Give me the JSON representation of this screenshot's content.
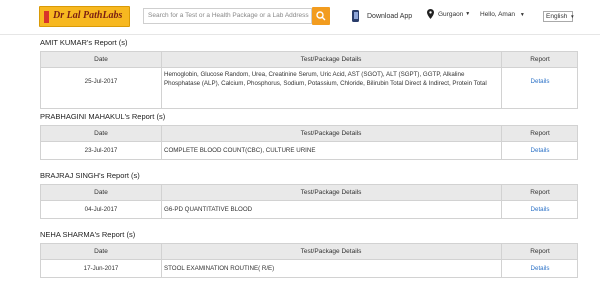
{
  "header": {
    "logo_text": "Dr Lal PathLabs",
    "search_placeholder": "Search for a Test or a Health Package or a Lab Address",
    "download_label": "Download App",
    "location": "Gurgaon",
    "greeting": "Hello, Aman",
    "language": "English"
  },
  "columns": {
    "date": "Date",
    "test": "Test/Package Details",
    "report": "Report"
  },
  "reports": [
    {
      "title": "AMIT KUMAR's Report (s)",
      "date": "25-Jul-2017",
      "tests": "Hemoglobin, Glucose Random, Urea, Creatinine Serum, Uric Acid, AST (SGOT), ALT (SGPT), GGTP, Alkaline Phosphatase (ALP), Calcium, Phosphorus, Sodium, Potassium, Chloride, Bilirubin Total Direct & Indirect, Protein Total",
      "link": "Details"
    },
    {
      "title": "PRABHAGINI MAHAKUL's Report (s)",
      "date": "23-Jul-2017",
      "tests": "COMPLETE BLOOD COUNT(CBC), CULTURE URINE",
      "link": "Details"
    },
    {
      "title": "BRAJRAJ SINGH's Report (s)",
      "date": "04-Jul-2017",
      "tests": "G6-PD QUANTITATIVE BLOOD",
      "link": "Details"
    },
    {
      "title": "NEHA SHARMA's Report (s)",
      "date": "17-Jun-2017",
      "tests": "STOOL EXAMINATION ROUTINE( R/E)",
      "link": "Details"
    }
  ]
}
